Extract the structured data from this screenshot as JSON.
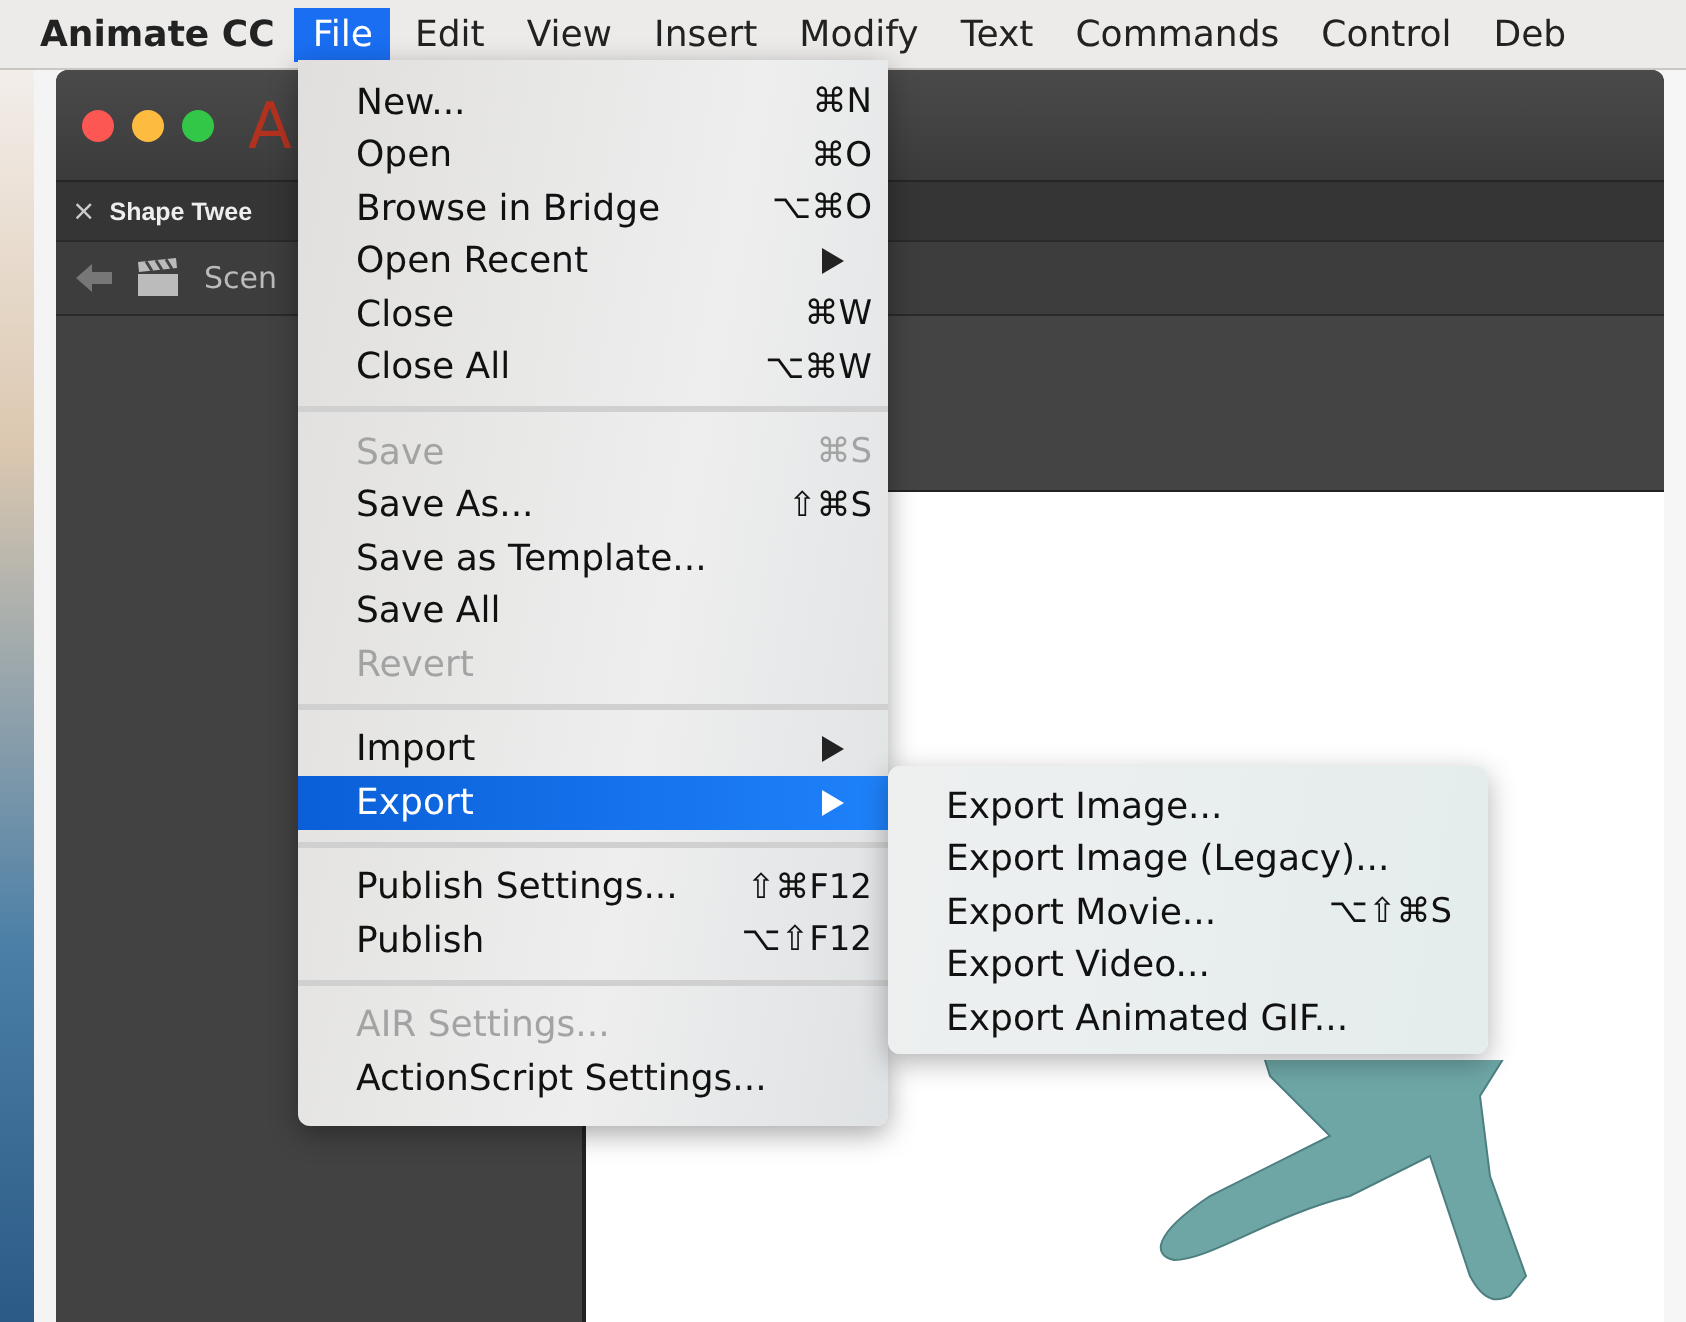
{
  "menu_bar": {
    "app_name": "Animate CC",
    "items": [
      {
        "label": "File",
        "selected": true
      },
      {
        "label": "Edit",
        "selected": false
      },
      {
        "label": "View",
        "selected": false
      },
      {
        "label": "Insert",
        "selected": false
      },
      {
        "label": "Modify",
        "selected": false
      },
      {
        "label": "Text",
        "selected": false
      },
      {
        "label": "Commands",
        "selected": false
      },
      {
        "label": "Control",
        "selected": false
      },
      {
        "label": "Deb",
        "selected": false
      }
    ]
  },
  "window": {
    "logo": "A",
    "tab": {
      "label": "Shape Twee",
      "close": "×"
    },
    "breadcrumb": "Scen"
  },
  "file_menu": {
    "groups": [
      [
        {
          "label": "New...",
          "shortcut": "⌘N",
          "disabled": false,
          "submenu": false,
          "selected": false
        },
        {
          "label": "Open",
          "shortcut": "⌘O",
          "disabled": false,
          "submenu": false,
          "selected": false
        },
        {
          "label": "Browse in Bridge",
          "shortcut": "⌥⌘O",
          "disabled": false,
          "submenu": false,
          "selected": false
        },
        {
          "label": "Open Recent",
          "disabled": false,
          "submenu": true,
          "selected": false
        },
        {
          "label": "Close",
          "shortcut": "⌘W",
          "disabled": false,
          "submenu": false,
          "selected": false
        },
        {
          "label": "Close All",
          "shortcut": "⌥⌘W",
          "disabled": false,
          "submenu": false,
          "selected": false
        }
      ],
      [
        {
          "label": "Save",
          "shortcut": "⌘S",
          "disabled": true,
          "submenu": false,
          "selected": false
        },
        {
          "label": "Save As...",
          "shortcut": "⇧⌘S",
          "disabled": false,
          "submenu": false,
          "selected": false
        },
        {
          "label": "Save as Template...",
          "disabled": false,
          "submenu": false,
          "selected": false
        },
        {
          "label": "Save All",
          "disabled": false,
          "submenu": false,
          "selected": false
        },
        {
          "label": "Revert",
          "disabled": true,
          "submenu": false,
          "selected": false
        }
      ],
      [
        {
          "label": "Import",
          "disabled": false,
          "submenu": true,
          "selected": false
        },
        {
          "label": "Export",
          "disabled": false,
          "submenu": true,
          "selected": true
        }
      ],
      [
        {
          "label": "Publish Settings...",
          "shortcut": "⇧⌘F12",
          "disabled": false,
          "submenu": false,
          "selected": false
        },
        {
          "label": "Publish",
          "shortcut": "⌥⇧F12",
          "disabled": false,
          "submenu": false,
          "selected": false
        }
      ],
      [
        {
          "label": "AIR Settings...",
          "disabled": true,
          "submenu": false,
          "selected": false
        },
        {
          "label": "ActionScript Settings...",
          "disabled": false,
          "submenu": false,
          "selected": false
        }
      ]
    ]
  },
  "export_submenu": [
    {
      "label": "Export Image..."
    },
    {
      "label": "Export Image (Legacy)..."
    },
    {
      "label": "Export Movie...",
      "shortcut": "⌥⇧⌘S"
    },
    {
      "label": "Export Video..."
    },
    {
      "label": "Export Animated GIF..."
    }
  ]
}
